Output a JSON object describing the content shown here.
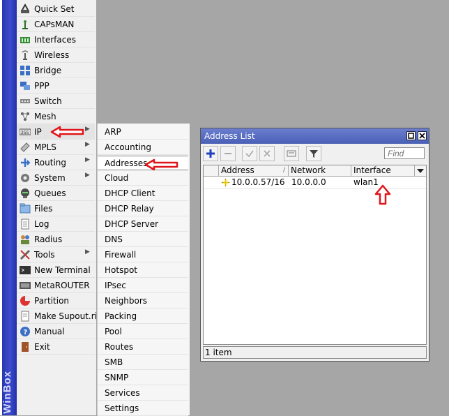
{
  "app": {
    "sidebar_title": "WinBox"
  },
  "menu": {
    "items": [
      {
        "label": "Quick Set",
        "icon": "quick-set-icon"
      },
      {
        "label": "CAPsMAN",
        "icon": "capsman-icon"
      },
      {
        "label": "Interfaces",
        "icon": "interfaces-icon"
      },
      {
        "label": "Wireless",
        "icon": "wireless-icon"
      },
      {
        "label": "Bridge",
        "icon": "bridge-icon"
      },
      {
        "label": "PPP",
        "icon": "ppp-icon"
      },
      {
        "label": "Switch",
        "icon": "switch-icon"
      },
      {
        "label": "Mesh",
        "icon": "mesh-icon"
      },
      {
        "label": "IP",
        "icon": "ip-icon",
        "submenu": true
      },
      {
        "label": "MPLS",
        "icon": "mpls-icon",
        "submenu": true
      },
      {
        "label": "Routing",
        "icon": "routing-icon",
        "submenu": true
      },
      {
        "label": "System",
        "icon": "system-icon",
        "submenu": true
      },
      {
        "label": "Queues",
        "icon": "queues-icon"
      },
      {
        "label": "Files",
        "icon": "files-icon"
      },
      {
        "label": "Log",
        "icon": "log-icon"
      },
      {
        "label": "Radius",
        "icon": "radius-icon"
      },
      {
        "label": "Tools",
        "icon": "tools-icon",
        "submenu": true
      },
      {
        "label": "New Terminal",
        "icon": "terminal-icon"
      },
      {
        "label": "MetaROUTER",
        "icon": "metarouter-icon"
      },
      {
        "label": "Partition",
        "icon": "partition-icon"
      },
      {
        "label": "Make Supout.rif",
        "icon": "supout-icon"
      },
      {
        "label": "Manual",
        "icon": "manual-icon"
      },
      {
        "label": "Exit",
        "icon": "exit-icon"
      }
    ],
    "submenu_glyph": "▶"
  },
  "ip_submenu": {
    "items": [
      "ARP",
      "Accounting",
      "Addresses",
      "Cloud",
      "DHCP Client",
      "DHCP Relay",
      "DHCP Server",
      "DNS",
      "Firewall",
      "Hotspot",
      "IPsec",
      "Neighbors",
      "Packing",
      "Pool",
      "Routes",
      "SMB",
      "SNMP",
      "Services",
      "Settings"
    ],
    "active_index": 2
  },
  "address_window": {
    "title": "Address List",
    "find_placeholder": "Find",
    "columns": [
      "Address",
      "Network",
      "Interface"
    ],
    "rows": [
      {
        "address": "10.0.0.57/16",
        "network": "10.0.0.0",
        "interface": "wlan1"
      }
    ],
    "status": "1 item"
  },
  "colors": {
    "annotation_red": "#e0151b",
    "title_blue": "#4f65bd",
    "add_blue": "#1f3fbf"
  }
}
